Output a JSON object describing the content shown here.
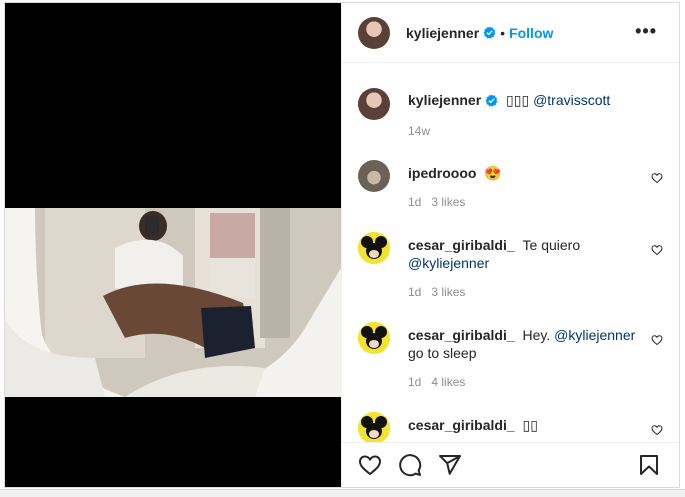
{
  "post": {
    "username": "kyliejenner",
    "follow_label": "Follow",
    "dot": "•",
    "more": "•••"
  },
  "caption": {
    "username": "kyliejenner",
    "text_prefix": "▯▯▯ ",
    "mention": "@travisscott",
    "time": "14w"
  },
  "comments": [
    {
      "username": "ipedroooo",
      "text": "😍",
      "time": "1d",
      "likes": "3 likes"
    },
    {
      "username": "cesar_giribaldi_",
      "text": "Te quiero",
      "mention": "@kyliejenner",
      "time": "1d",
      "likes": "3 likes"
    },
    {
      "username": "cesar_giribaldi_",
      "text": "Hey.",
      "mention": "@kyliejenner",
      "text_after": "go to sleep",
      "time": "1d",
      "likes": "4 likes"
    },
    {
      "username": "cesar_giribaldi_",
      "text": "▯▯"
    }
  ],
  "colors": {
    "accent": "#0095f6",
    "verified": "#0095f6",
    "mention": "#00376b",
    "meta": "#8e8e8e"
  },
  "icons": {
    "like": "heart-icon",
    "comment": "comment-icon",
    "share": "share-icon",
    "save": "bookmark-icon",
    "more": "more-icon"
  }
}
